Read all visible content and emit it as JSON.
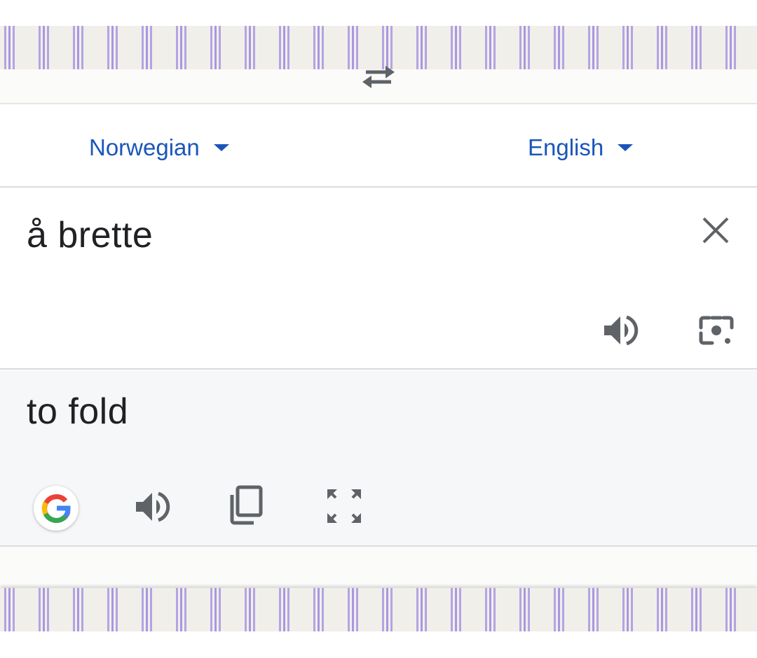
{
  "languages": {
    "source": "Norwegian",
    "target": "English"
  },
  "source": {
    "text": "å brette"
  },
  "result": {
    "text": "to fold"
  },
  "icons": {
    "dropdown": "chevron-down-icon",
    "swap": "swap-icon",
    "clear": "close-icon",
    "speak": "speaker-icon",
    "camera": "camera-icon",
    "google": "google-logo-icon",
    "copy": "copy-icon",
    "fullscreen": "fullscreen-icon"
  },
  "colors": {
    "accent": "#1a56b9",
    "icon": "#5f6368",
    "result_bg": "#f6f7f8"
  }
}
